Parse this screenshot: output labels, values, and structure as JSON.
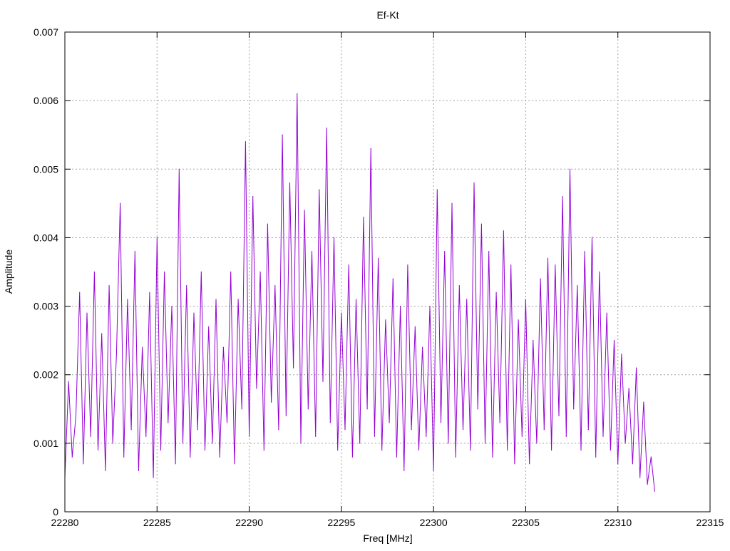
{
  "chart_data": {
    "type": "line",
    "title": "Ef-Kt",
    "xlabel": "Freq [MHz]",
    "ylabel": "Amplitude",
    "xlim": [
      22280,
      22315
    ],
    "ylim": [
      0,
      0.007
    ],
    "xticks": [
      22280,
      22285,
      22290,
      22295,
      22300,
      22305,
      22310,
      22315
    ],
    "xtick_labels": [
      "22280",
      "22285",
      "22290",
      "22295",
      "22300",
      "22305",
      "22310",
      "22315"
    ],
    "yticks": [
      0,
      0.001,
      0.002,
      0.003,
      0.004,
      0.005,
      0.006,
      0.007
    ],
    "ytick_labels": [
      "0",
      "0.001",
      "0.002",
      "0.003",
      "0.004",
      "0.005",
      "0.006",
      "0.007"
    ],
    "grid": true,
    "legend": "none",
    "series_color": "#9400d3",
    "grid_color": "#a0a0a0",
    "series": [
      {
        "name": "",
        "x": [
          22280.0,
          22280.2,
          22280.4,
          22280.6,
          22280.8,
          22281.0,
          22281.2,
          22281.4,
          22281.6,
          22281.8,
          22282.0,
          22282.2,
          22282.4,
          22282.6,
          22282.8,
          22283.0,
          22283.2,
          22283.4,
          22283.6,
          22283.8,
          22284.0,
          22284.2,
          22284.4,
          22284.6,
          22284.8,
          22285.0,
          22285.2,
          22285.4,
          22285.6,
          22285.8,
          22286.0,
          22286.2,
          22286.4,
          22286.6,
          22286.8,
          22287.0,
          22287.2,
          22287.4,
          22287.6,
          22287.8,
          22288.0,
          22288.2,
          22288.4,
          22288.6,
          22288.8,
          22289.0,
          22289.2,
          22289.4,
          22289.6,
          22289.8,
          22290.0,
          22290.2,
          22290.4,
          22290.6,
          22290.8,
          22291.0,
          22291.2,
          22291.4,
          22291.6,
          22291.8,
          22292.0,
          22292.2,
          22292.4,
          22292.6,
          22292.8,
          22293.0,
          22293.2,
          22293.4,
          22293.6,
          22293.8,
          22294.0,
          22294.2,
          22294.4,
          22294.6,
          22294.8,
          22295.0,
          22295.2,
          22295.4,
          22295.6,
          22295.8,
          22296.0,
          22296.2,
          22296.4,
          22296.6,
          22296.8,
          22297.0,
          22297.2,
          22297.4,
          22297.6,
          22297.8,
          22298.0,
          22298.2,
          22298.4,
          22298.6,
          22298.8,
          22299.0,
          22299.2,
          22299.4,
          22299.6,
          22299.8,
          22300.0,
          22300.2,
          22300.4,
          22300.6,
          22300.8,
          22301.0,
          22301.2,
          22301.4,
          22301.6,
          22301.8,
          22302.0,
          22302.2,
          22302.4,
          22302.6,
          22302.8,
          22303.0,
          22303.2,
          22303.4,
          22303.6,
          22303.8,
          22304.0,
          22304.2,
          22304.4,
          22304.6,
          22304.8,
          22305.0,
          22305.2,
          22305.4,
          22305.6,
          22305.8,
          22306.0,
          22306.2,
          22306.4,
          22306.6,
          22306.8,
          22307.0,
          22307.2,
          22307.4,
          22307.6,
          22307.8,
          22308.0,
          22308.2,
          22308.4,
          22308.6,
          22308.8,
          22309.0,
          22309.2,
          22309.4,
          22309.6,
          22309.8,
          22310.0,
          22310.2,
          22310.4,
          22310.6,
          22310.8,
          22311.0,
          22311.2,
          22311.4,
          22311.6,
          22311.8,
          22312.0
        ],
        "y": [
          0.0005,
          0.0019,
          0.0008,
          0.0014,
          0.0032,
          0.0007,
          0.0029,
          0.0011,
          0.0035,
          0.0009,
          0.0026,
          0.0006,
          0.0033,
          0.001,
          0.0023,
          0.0045,
          0.0008,
          0.0031,
          0.0012,
          0.0038,
          0.0006,
          0.0024,
          0.0011,
          0.0032,
          0.0005,
          0.004,
          0.0009,
          0.0035,
          0.0013,
          0.003,
          0.0007,
          0.005,
          0.001,
          0.0033,
          0.0008,
          0.0029,
          0.0012,
          0.0035,
          0.0009,
          0.0027,
          0.001,
          0.0031,
          0.0008,
          0.0024,
          0.0013,
          0.0035,
          0.0007,
          0.0031,
          0.0015,
          0.0054,
          0.0011,
          0.0046,
          0.0018,
          0.0035,
          0.0009,
          0.0042,
          0.0016,
          0.0033,
          0.0012,
          0.0055,
          0.0014,
          0.0048,
          0.0021,
          0.0061,
          0.001,
          0.0044,
          0.0015,
          0.0038,
          0.0011,
          0.0047,
          0.0019,
          0.0056,
          0.0013,
          0.004,
          0.0009,
          0.0029,
          0.0012,
          0.0036,
          0.0008,
          0.0031,
          0.001,
          0.0043,
          0.0015,
          0.0053,
          0.0011,
          0.0037,
          0.0009,
          0.0028,
          0.0013,
          0.0034,
          0.0008,
          0.003,
          0.0006,
          0.0036,
          0.0012,
          0.0027,
          0.0009,
          0.0024,
          0.0011,
          0.003,
          0.0006,
          0.0047,
          0.0013,
          0.0038,
          0.001,
          0.0045,
          0.0008,
          0.0033,
          0.0012,
          0.0031,
          0.0009,
          0.0048,
          0.0015,
          0.0042,
          0.001,
          0.0038,
          0.0008,
          0.0032,
          0.0013,
          0.0041,
          0.0009,
          0.0036,
          0.0007,
          0.0028,
          0.0011,
          0.0031,
          0.0007,
          0.0025,
          0.001,
          0.0034,
          0.0012,
          0.0037,
          0.0009,
          0.0036,
          0.0014,
          0.0046,
          0.0011,
          0.005,
          0.0015,
          0.0033,
          0.0009,
          0.0038,
          0.0012,
          0.004,
          0.0008,
          0.0035,
          0.0011,
          0.0029,
          0.0009,
          0.0025,
          0.0007,
          0.0023,
          0.001,
          0.0018,
          0.0007,
          0.0021,
          0.0005,
          0.0016,
          0.0004,
          0.0008,
          0.0003
        ]
      }
    ]
  }
}
